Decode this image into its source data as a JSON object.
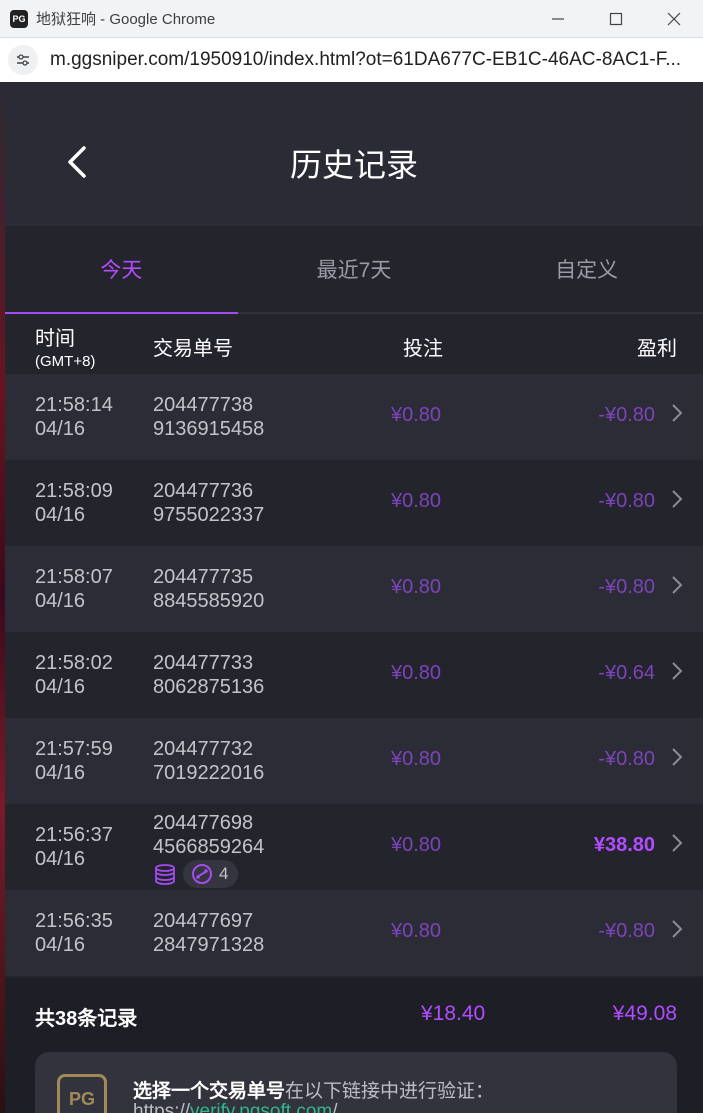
{
  "window": {
    "title": "地狱狂响 - Google Chrome",
    "favicon_text": "PG",
    "url": "m.ggsniper.com/1950910/index.html?ot=61DA677C-EB1C-46AC-8AC1-F..."
  },
  "header": {
    "title": "历史记录"
  },
  "tabs": [
    {
      "label": "今天",
      "active": true
    },
    {
      "label": "最近7天",
      "active": false
    },
    {
      "label": "自定义",
      "active": false
    }
  ],
  "columns": {
    "time": "时间",
    "timezone": "(GMT+8)",
    "tx": "交易单号",
    "bet": "投注",
    "profit": "盈利"
  },
  "rows": [
    {
      "time": "21:58:14",
      "date": "04/16",
      "tx1": "204477738",
      "tx2": "9136915458",
      "bet": "¥0.80",
      "profit": "-¥0.80"
    },
    {
      "time": "21:58:09",
      "date": "04/16",
      "tx1": "204477736",
      "tx2": "9755022337",
      "bet": "¥0.80",
      "profit": "-¥0.80"
    },
    {
      "time": "21:58:07",
      "date": "04/16",
      "tx1": "204477735",
      "tx2": "8845585920",
      "bet": "¥0.80",
      "profit": "-¥0.80"
    },
    {
      "time": "21:58:02",
      "date": "04/16",
      "tx1": "204477733",
      "tx2": "8062875136",
      "bet": "¥0.80",
      "profit": "-¥0.64"
    },
    {
      "time": "21:57:59",
      "date": "04/16",
      "tx1": "204477732",
      "tx2": "7019222016",
      "bet": "¥0.80",
      "profit": "-¥0.80"
    },
    {
      "time": "21:56:37",
      "date": "04/16",
      "tx1": "204477698",
      "tx2": "4566859264",
      "bet": "¥0.80",
      "profit": "¥38.80",
      "free_spins": "4"
    },
    {
      "time": "21:56:35",
      "date": "04/16",
      "tx1": "204477697",
      "tx2": "2847971328",
      "bet": "¥0.80",
      "profit": "-¥0.80"
    }
  ],
  "summary": {
    "label": "共38条记录",
    "total_bet": "¥18.40",
    "total_profit": "¥49.08"
  },
  "verify": {
    "strong": "选择一个交易单号",
    "normal": "在以下链接中进行验证：",
    "link_prefix": "https://",
    "link_domain": "verify.pgsoft.com",
    "link_suffix": "/",
    "badge": "PG"
  },
  "colors": {
    "accent": "#b14cff",
    "loss": "#7a45b8",
    "bg": "#24242d",
    "row_alt": "#2c2c36"
  }
}
